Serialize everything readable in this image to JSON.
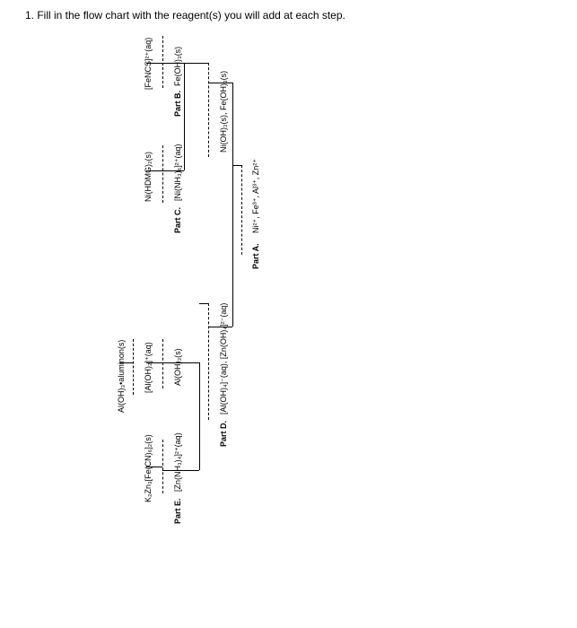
{
  "question": "1. Fill in the flow chart with the reagent(s) you will add at each step.",
  "root": {
    "part": "Part A.",
    "species": "Ni²⁺, Fe³⁺, Al³⁺, Zn²⁺"
  },
  "left1": {
    "part": "Part D.",
    "species": "[Al(OH)₄]⁻(aq), [Zn(OH)₄]²⁻(aq)"
  },
  "right1": {
    "species": "Ni(OH)₂(s), Fe(OH)₃(s)"
  },
  "left2a": {
    "part": "Part E.",
    "species": "[Zn(NH₃)₄]²⁺(aq)"
  },
  "left2b": {
    "species": "Al(OH)₃(s)"
  },
  "right2a": {
    "part": "Part C.",
    "species": "[Ni(NH₃)₆]²⁺(aq)"
  },
  "right2b": {
    "part": "Part B.",
    "species": "Fe(OH)₃(s)"
  },
  "leaf_left_a": {
    "species": "K₂Zn₃[Fe(CN)₆]₂(s)"
  },
  "leaf_left_b": {
    "species": "[Al(OH)₂]⁺(aq)"
  },
  "leaf_left_b2": {
    "species": "Al(OH)₃•aluminon(s)"
  },
  "leaf_right_a": {
    "species": "Ni(HDMG)₂(s)"
  },
  "leaf_right_b": {
    "species": "[FeNCS]²⁺(aq)"
  }
}
